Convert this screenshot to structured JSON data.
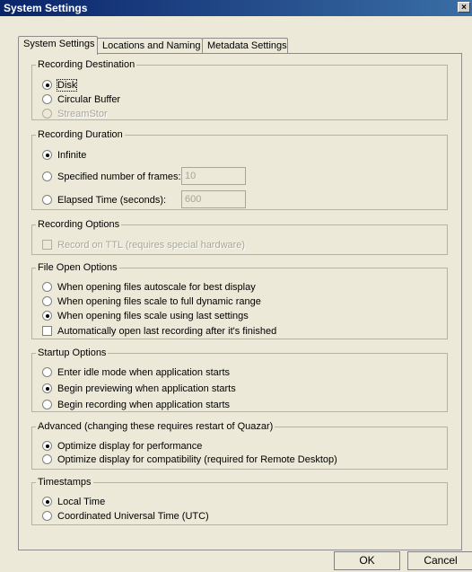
{
  "window": {
    "title": "System Settings",
    "close_glyph": "×"
  },
  "tabs": [
    {
      "label": "System Settings",
      "active": true
    },
    {
      "label": "Locations and Naming",
      "active": false
    },
    {
      "label": "Metadata Settings",
      "active": false
    }
  ],
  "recording_destination": {
    "legend": "Recording Destination",
    "options": [
      {
        "label": "Disk",
        "checked": true,
        "enabled": true
      },
      {
        "label": "Circular Buffer",
        "checked": false,
        "enabled": true
      },
      {
        "label": "StreamStor",
        "checked": false,
        "enabled": false
      }
    ]
  },
  "recording_duration": {
    "legend": "Recording Duration",
    "options": [
      {
        "label": "Infinite",
        "checked": true
      },
      {
        "label": "Specified number of frames:",
        "checked": false,
        "value": "10"
      },
      {
        "label": "Elapsed Time (seconds):",
        "checked": false,
        "value": "600"
      }
    ]
  },
  "recording_options": {
    "legend": "Recording Options",
    "record_on_ttl": {
      "label": "Record on TTL (requires special hardware)",
      "checked": false,
      "enabled": false
    }
  },
  "file_open_options": {
    "legend": "File Open Options",
    "options": [
      {
        "label": "When opening files autoscale for best display",
        "checked": false
      },
      {
        "label": "When opening files scale to full dynamic range",
        "checked": false
      },
      {
        "label": "When opening files scale using last settings",
        "checked": true
      }
    ],
    "auto_open": {
      "label": "Automatically open last recording after it's finished",
      "checked": false
    }
  },
  "startup_options": {
    "legend": "Startup Options",
    "options": [
      {
        "label": "Enter idle mode when application starts",
        "checked": false
      },
      {
        "label": "Begin previewing when application starts",
        "checked": true
      },
      {
        "label": "Begin recording when application starts",
        "checked": false
      }
    ]
  },
  "advanced": {
    "legend": "Advanced (changing these requires restart of Quazar)",
    "options": [
      {
        "label": "Optimize display for performance",
        "checked": true
      },
      {
        "label": "Optimize display for compatibility (required for Remote Desktop)",
        "checked": false
      }
    ]
  },
  "timestamps": {
    "legend": "Timestamps",
    "options": [
      {
        "label": "Local Time",
        "checked": true
      },
      {
        "label": "Coordinated Universal Time (UTC)",
        "checked": false
      }
    ]
  },
  "buttons": {
    "ok": "OK",
    "cancel": "Cancel"
  }
}
